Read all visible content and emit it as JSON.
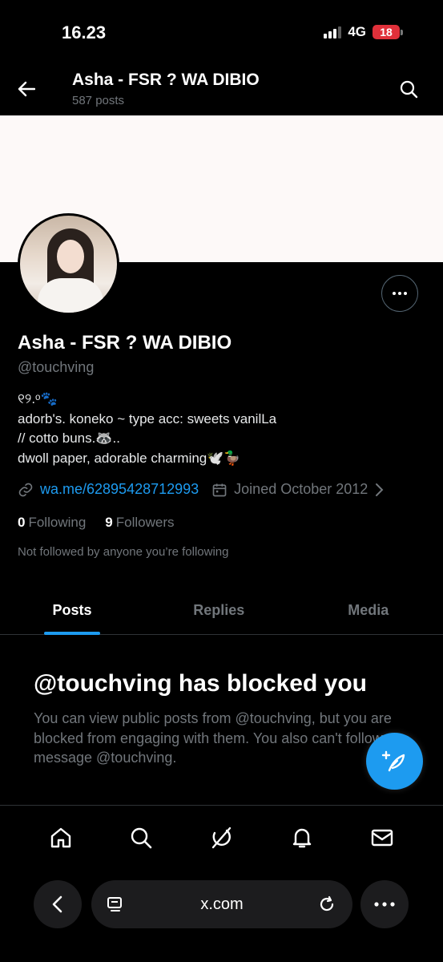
{
  "status_bar": {
    "time": "16.23",
    "network": "4G",
    "battery": "18"
  },
  "header": {
    "title": "Asha - FSR ? WA DIBIO",
    "subtitle": "587 posts"
  },
  "profile": {
    "name": "Asha - FSR ? WA DIBIO",
    "handle": "@touchving",
    "bio": "୧୨.ᵒ🐾\nadorb's. koneko ~ type acc: sweets vanilLa\n// cotto buns.🦝..\ndwoll paper, adorable charming🕊️🦆",
    "link": "wa.me/62895428712993",
    "joined": "Joined October 2012",
    "following_count": "0",
    "following_label": "Following",
    "followers_count": "9",
    "followers_label": "Followers",
    "not_followed": "Not followed by anyone you’re following"
  },
  "tabs": [
    {
      "label": "Posts",
      "active": true
    },
    {
      "label": "Replies",
      "active": false
    },
    {
      "label": "Media",
      "active": false
    }
  ],
  "blocked": {
    "title": "@touchving has blocked you",
    "text": "You can view public posts from @touchving, but you are blocked from engaging with them. You also can't follow or message @touchving."
  },
  "bottom_nav": [
    "home-icon",
    "search-icon",
    "grok-icon",
    "bell-icon",
    "mail-icon"
  ],
  "browser": {
    "url": "x.com"
  },
  "colors": {
    "accent": "#1d9bf0",
    "background": "#000000",
    "muted": "#71767b",
    "battery_low": "#e0303a"
  }
}
